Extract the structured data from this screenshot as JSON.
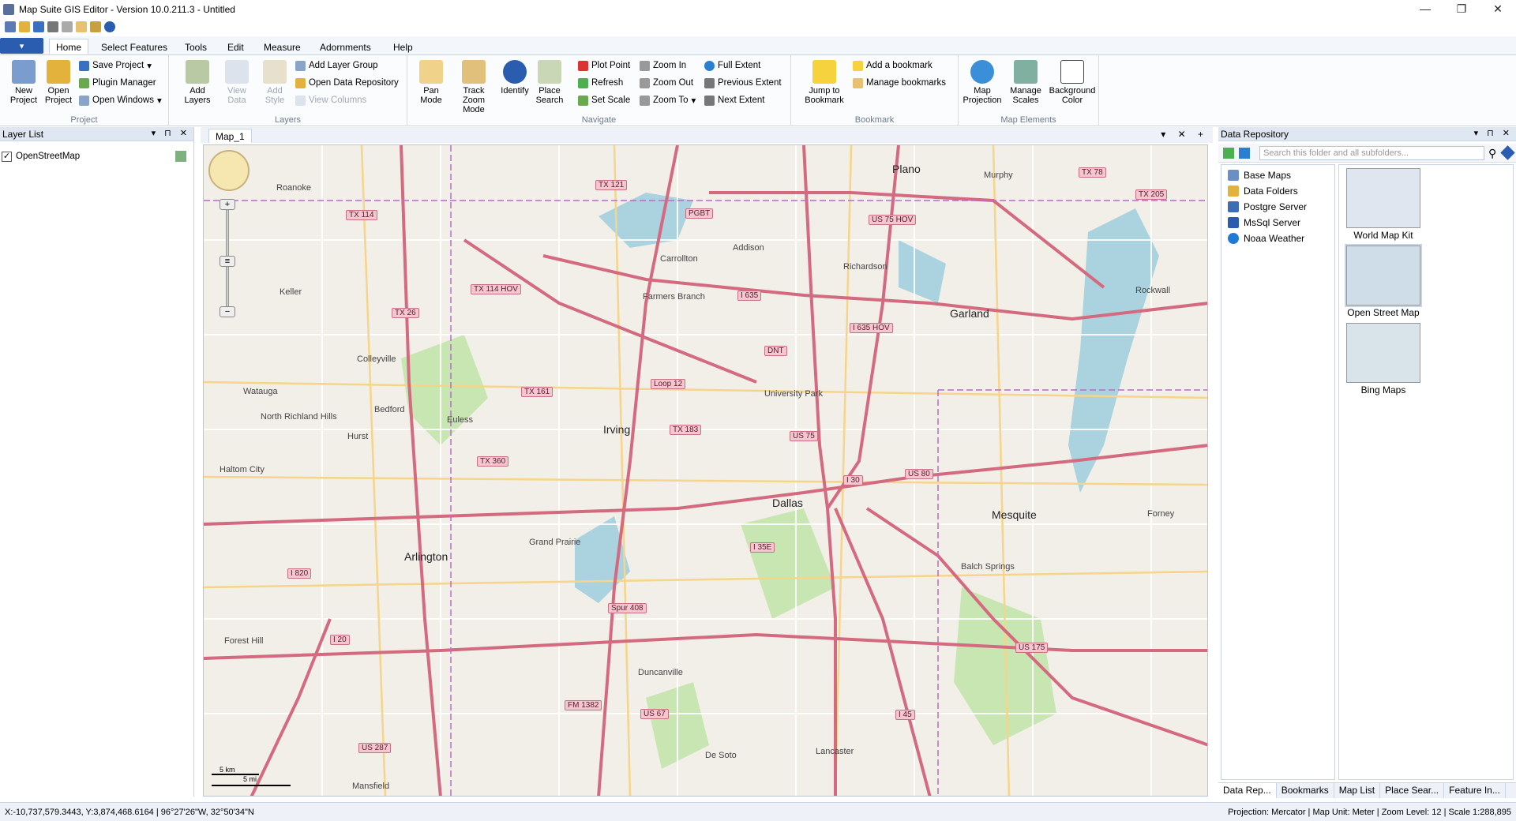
{
  "window": {
    "title": "Map Suite GIS Editor - Version 10.0.211.3 - Untitled",
    "minimize": "—",
    "restore": "❐",
    "close": "✕"
  },
  "tabs": [
    "Home",
    "Select Features",
    "Tools",
    "Edit",
    "Measure",
    "Adornments",
    "Help"
  ],
  "ribbon": {
    "project": {
      "label": "Project",
      "new_project": "New Project",
      "open_project": "Open Project",
      "save_project": "Save Project",
      "plugin_manager": "Plugin Manager",
      "open_windows": "Open Windows"
    },
    "layers": {
      "label": "Layers",
      "add_layers": "Add Layers",
      "view_data": "View Data",
      "add_style": "Add Style",
      "add_layer_group": "Add Layer Group",
      "open_data_repository": "Open Data Repository",
      "view_columns": "View Columns"
    },
    "navigate": {
      "label": "Navigate",
      "pan_mode": "Pan Mode",
      "track_zoom_mode": "Track Zoom Mode",
      "identify": "Identify",
      "place_search": "Place Search",
      "plot_point": "Plot Point",
      "refresh": "Refresh",
      "set_scale": "Set Scale",
      "zoom_in": "Zoom In",
      "zoom_out": "Zoom Out",
      "zoom_to": "Zoom To",
      "full_extent": "Full Extent",
      "previous_extent": "Previous Extent",
      "next_extent": "Next Extent"
    },
    "bookmark": {
      "label": "Bookmark",
      "jump_to_bookmark": "Jump to Bookmark",
      "add_a_bookmark": "Add a bookmark",
      "manage_bookmarks": "Manage bookmarks"
    },
    "map_elements": {
      "label": "Map Elements",
      "map_projection": "Map Projection",
      "manage_scales": "Manage Scales",
      "background_color": "Background Color"
    }
  },
  "layer_list": {
    "title": "Layer List",
    "layers": [
      {
        "name": "OpenStreetMap",
        "checked": true
      }
    ]
  },
  "map": {
    "tab": "Map_1",
    "scale_km": "5 km",
    "scale_mi": "5 mi",
    "cities": [
      "Plano",
      "Garland",
      "Irving",
      "Dallas",
      "Mesquite",
      "Arlington",
      "Grand Prairie",
      "Carrollton",
      "Farmers Branch",
      "Addison",
      "Richardson",
      "Rockwall",
      "Murphy",
      "Keller",
      "Colleyville",
      "Bedford",
      "Euless",
      "Hurst",
      "Watauga",
      "North Richland Hills",
      "Haltom City",
      "Roanoke",
      "Forney",
      "Balch Springs",
      "Duncanville",
      "Lancaster",
      "De Soto",
      "Forest Hill",
      "Mansfield",
      "University Park"
    ],
    "shields": [
      "TX 121",
      "TX 114",
      "TX 114 HOV",
      "PGBT",
      "US 75 HOV",
      "TX 78",
      "TX 205",
      "I 635",
      "I 635 HOV",
      "DNT",
      "TX 161",
      "Loop 12",
      "US 75",
      "TX 183",
      "TX 360",
      "I 30",
      "US 80",
      "I 35E",
      "I 20",
      "US 287",
      "I 820",
      "Spur 408",
      "FM 1382",
      "US 67",
      "US 175",
      "I 45",
      "TX 26"
    ]
  },
  "repository": {
    "title": "Data Repository",
    "search_placeholder": "Search this folder and all subfolders...",
    "tree": [
      "Base Maps",
      "Data Folders",
      "Postgre Server",
      "MsSql Server",
      "Noaa Weather"
    ],
    "thumbs": [
      "World Map Kit",
      "Open Street Map",
      "Bing Maps"
    ],
    "bottom_tabs": [
      "Data Rep...",
      "Bookmarks",
      "Map List",
      "Place Sear...",
      "Feature In..."
    ]
  },
  "status": {
    "coords": "X:-10,737,579.3443, Y:3,874,468.6164 | 96°27'26\"W, 32°50'34\"N",
    "info": "Projection: Mercator | Map Unit: Meter | Zoom Level: 12 | Scale 1:288,895"
  },
  "colors": {
    "accent": "#2a5db0",
    "road": "#d46a80",
    "map_bg": "#f2efe9",
    "water": "#aad3df",
    "park": "#c8e6b2"
  }
}
